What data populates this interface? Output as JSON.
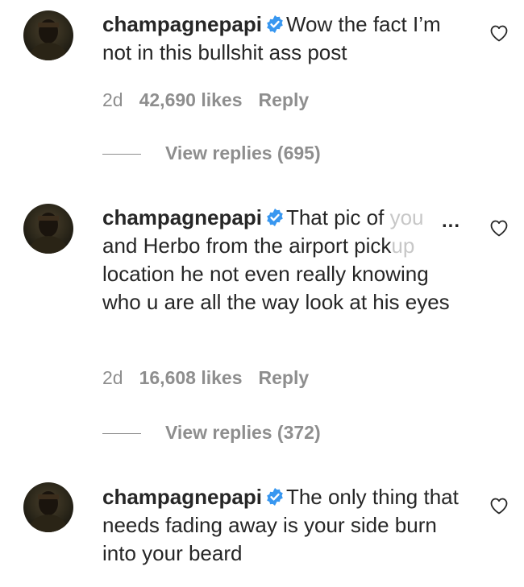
{
  "comments": [
    {
      "username": "champagnepapi",
      "text": "Wow the fact I’m not in this bullshit ass post",
      "time": "2d",
      "likes": "42,690 likes",
      "reply_label": "Reply",
      "view_replies": "View replies (695)"
    },
    {
      "username": "champagnepapi",
      "text_visible_1": "That pic of ",
      "text_faded_1": "you",
      "text_visible_2": "and Herbo from the airport pick",
      "text_faded_2": "up",
      "text_visible_3": "location he not even really knowing who u are all the way look at his eyes",
      "more": "...",
      "time": "2d",
      "likes": "16,608 likes",
      "reply_label": "Reply",
      "view_replies": "View replies (372)"
    },
    {
      "username": "champagnepapi",
      "text": "The only thing that needs fading away is your side burn into your beard"
    }
  ],
  "icons": {
    "verified": "verified-badge-icon",
    "heart": "heart-outline-icon",
    "verified_color": "#3897f0"
  }
}
